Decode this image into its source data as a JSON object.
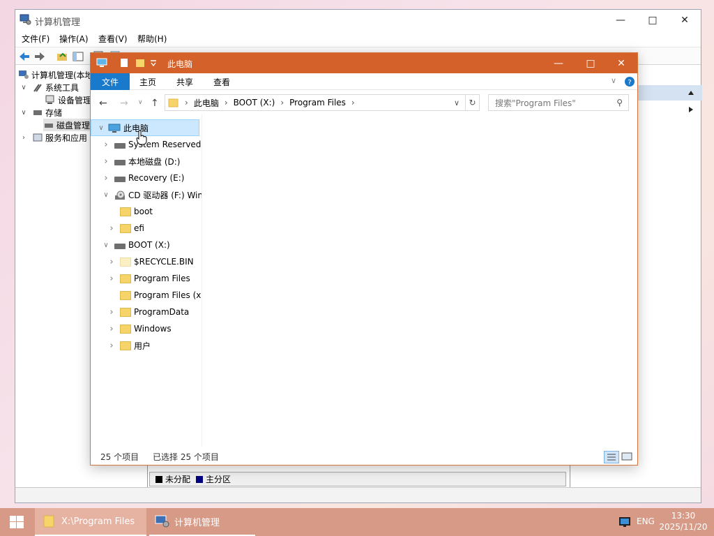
{
  "cm": {
    "title": "计算机管理",
    "menu": [
      "文件(F)",
      "操作(A)",
      "查看(V)",
      "帮助(H)"
    ],
    "tree": [
      {
        "label": "计算机管理(本地",
        "level": 0,
        "chevron": ""
      },
      {
        "label": "系统工具",
        "level": 1,
        "chevron": "expanded"
      },
      {
        "label": "设备管理",
        "level": 2,
        "chevron": ""
      },
      {
        "label": "存储",
        "level": 1,
        "chevron": "expanded"
      },
      {
        "label": "磁盘管理",
        "level": 2,
        "chevron": ""
      },
      {
        "label": "服务和应用",
        "level": 1,
        "chevron": "collapsed"
      }
    ],
    "legend": {
      "unallocated": "未分配",
      "primary": "主分区",
      "unallocated_color": "#000000",
      "primary_color": "#000080"
    }
  },
  "explorer": {
    "title": "此电脑",
    "ribbon_tabs": [
      "文件",
      "主页",
      "共享",
      "查看"
    ],
    "breadcrumb": [
      "此电脑",
      "BOOT (X:)",
      "Program Files"
    ],
    "search_placeholder": "搜索\"Program Files\"",
    "tree": [
      {
        "label": "此电脑",
        "indent": 0,
        "chevron": "expanded",
        "icon": "computer",
        "selected": true
      },
      {
        "label": "System Reserved",
        "indent": 1,
        "chevron": "collapsed",
        "icon": "drive"
      },
      {
        "label": "本地磁盘 (D:)",
        "indent": 1,
        "chevron": "collapsed",
        "icon": "drive"
      },
      {
        "label": "Recovery (E:)",
        "indent": 1,
        "chevron": "collapsed",
        "icon": "drive"
      },
      {
        "label": "CD 驱动器 (F:) Win",
        "indent": 1,
        "chevron": "expanded",
        "icon": "cd"
      },
      {
        "label": "boot",
        "indent": 2,
        "chevron": "",
        "icon": "folder"
      },
      {
        "label": "efi",
        "indent": 2,
        "chevron": "collapsed",
        "icon": "folder"
      },
      {
        "label": "BOOT (X:)",
        "indent": 1,
        "chevron": "expanded",
        "icon": "drive"
      },
      {
        "label": "$RECYCLE.BIN",
        "indent": 2,
        "chevron": "collapsed",
        "icon": "folder-pale"
      },
      {
        "label": "Program Files",
        "indent": 2,
        "chevron": "collapsed",
        "icon": "folder"
      },
      {
        "label": "Program Files (x",
        "indent": 2,
        "chevron": "",
        "icon": "folder"
      },
      {
        "label": "ProgramData",
        "indent": 2,
        "chevron": "collapsed",
        "icon": "folder"
      },
      {
        "label": "Windows",
        "indent": 2,
        "chevron": "collapsed",
        "icon": "folder"
      },
      {
        "label": "用户",
        "indent": 2,
        "chevron": "collapsed",
        "icon": "folder"
      }
    ],
    "status_count": "25 个项目",
    "status_selected": "已选择 25 个项目"
  },
  "taskbar": {
    "items": [
      {
        "label": "X:\\Program Files",
        "icon": "folder-icon",
        "active": true
      },
      {
        "label": "计算机管理",
        "icon": "computer-management-icon",
        "active": false
      }
    ],
    "lang": "ENG",
    "time": "13:30",
    "date": "2025/11/20"
  },
  "colors": {
    "explorer_title": "#d4602a",
    "ribbon_file_tab": "#1979ca",
    "taskbar": "#d79a87"
  }
}
